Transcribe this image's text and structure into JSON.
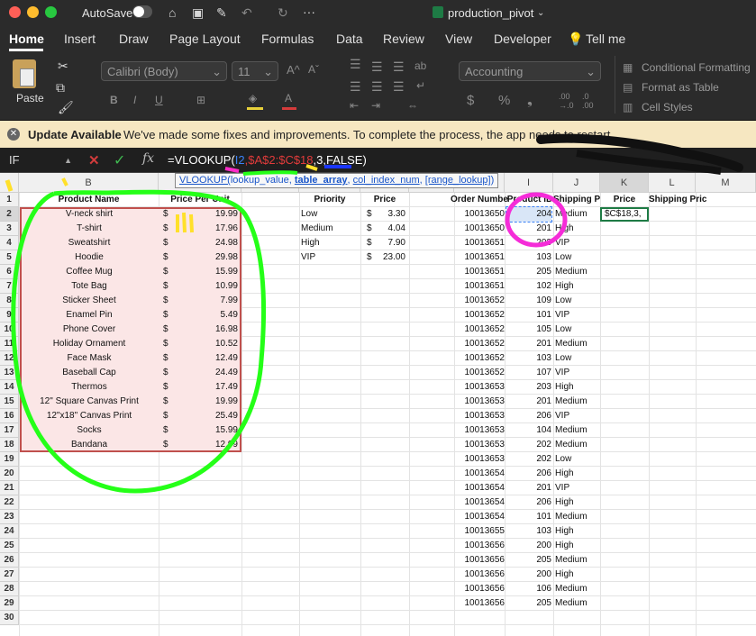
{
  "window": {
    "autosave": "AutoSave",
    "title": "production_pivot"
  },
  "tabs": [
    "Home",
    "Insert",
    "Draw",
    "Page Layout",
    "Formulas",
    "Data",
    "Review",
    "View",
    "Developer",
    "Tell me"
  ],
  "ribbon": {
    "paste": "Paste",
    "font": "Calibri (Body)",
    "size": "11",
    "number_format": "Accounting",
    "conditional": "Conditional Formatting",
    "format_table": "Format as Table",
    "cell_styles": "Cell Styles",
    "fill_color": "#e8d13a",
    "font_color": "#d63b3b"
  },
  "notice": {
    "title": "Update Available",
    "message": "We've made some fixes and improvements. To complete the process, the app needs to restart."
  },
  "formula": {
    "namebox": "IF",
    "fx": "fx",
    "text_prefix": "=VLOOKUP(",
    "arg1": "I2",
    "arg2": ",$A$2:$C$18",
    "text_suffix": ",3,FALSE)",
    "arg1_color": "#3b82f6",
    "arg2_color": "#e23b3b"
  },
  "tooltip": {
    "func": "VLOOKUP(",
    "a1": "lookup_value",
    "a2": "table_array",
    "a3": "col_index_num",
    "a4": "[range_lookup]",
    "close": ")"
  },
  "columns": [
    "B",
    "",
    "",
    "",
    "",
    "",
    "",
    "I",
    "J",
    "K",
    "L",
    "M"
  ],
  "headers": {
    "product": "Product Name",
    "ppu": "Price Per Unit",
    "priority": "Priority",
    "price": "Price",
    "order": "Order Number",
    "pid": "Product ID",
    "shp": "Shipping Priority",
    "k": "Price",
    "l": "Shipping Price"
  },
  "products": [
    [
      "V-neck shirt",
      "19.99"
    ],
    [
      "T-shirt",
      "17.96"
    ],
    [
      "Sweatshirt",
      "24.98"
    ],
    [
      "Hoodie",
      "29.98"
    ],
    [
      "Coffee Mug",
      "15.99"
    ],
    [
      "Tote Bag",
      "10.99"
    ],
    [
      "Sticker Sheet",
      "7.99"
    ],
    [
      "Enamel Pin",
      "5.49"
    ],
    [
      "Phone Cover",
      "16.98"
    ],
    [
      "Holiday Ornament",
      "10.52"
    ],
    [
      "Face Mask",
      "12.49"
    ],
    [
      "Baseball Cap",
      "24.49"
    ],
    [
      "Thermos",
      "17.49"
    ],
    [
      "12\" Square Canvas Print",
      "19.99"
    ],
    [
      "12\"x18\" Canvas Print",
      "25.49"
    ],
    [
      "Socks",
      "15.99"
    ],
    [
      "Bandana",
      "12.99"
    ]
  ],
  "priorities": [
    [
      "Low",
      "3.30"
    ],
    [
      "Medium",
      "4.04"
    ],
    [
      "High",
      "7.90"
    ],
    [
      "VIP",
      "23.00"
    ]
  ],
  "orders": [
    [
      "10013650",
      "204",
      "Medium"
    ],
    [
      "10013650",
      "201",
      "High"
    ],
    [
      "10013651",
      "203",
      "VIP"
    ],
    [
      "10013651",
      "103",
      "Low"
    ],
    [
      "10013651",
      "205",
      "Medium"
    ],
    [
      "10013651",
      "102",
      "High"
    ],
    [
      "10013652",
      "109",
      "Low"
    ],
    [
      "10013652",
      "101",
      "VIP"
    ],
    [
      "10013652",
      "105",
      "Low"
    ],
    [
      "10013652",
      "201",
      "Medium"
    ],
    [
      "10013652",
      "103",
      "Low"
    ],
    [
      "10013652",
      "107",
      "VIP"
    ],
    [
      "10013653",
      "203",
      "High"
    ],
    [
      "10013653",
      "201",
      "Medium"
    ],
    [
      "10013653",
      "206",
      "VIP"
    ],
    [
      "10013653",
      "104",
      "Medium"
    ],
    [
      "10013653",
      "202",
      "Medium"
    ],
    [
      "10013653",
      "202",
      "Low"
    ],
    [
      "10013654",
      "206",
      "High"
    ],
    [
      "10013654",
      "201",
      "VIP"
    ],
    [
      "10013654",
      "206",
      "High"
    ],
    [
      "10013654",
      "101",
      "Medium"
    ],
    [
      "10013655",
      "103",
      "High"
    ],
    [
      "10013656",
      "200",
      "High"
    ],
    [
      "10013656",
      "205",
      "Medium"
    ],
    [
      "10013656",
      "200",
      "High"
    ],
    [
      "10013656",
      "106",
      "Medium"
    ],
    [
      "10013656",
      "205",
      "Medium"
    ]
  ],
  "k2_text": "$C$18,3,",
  "currency": "$",
  "row_count": 30
}
